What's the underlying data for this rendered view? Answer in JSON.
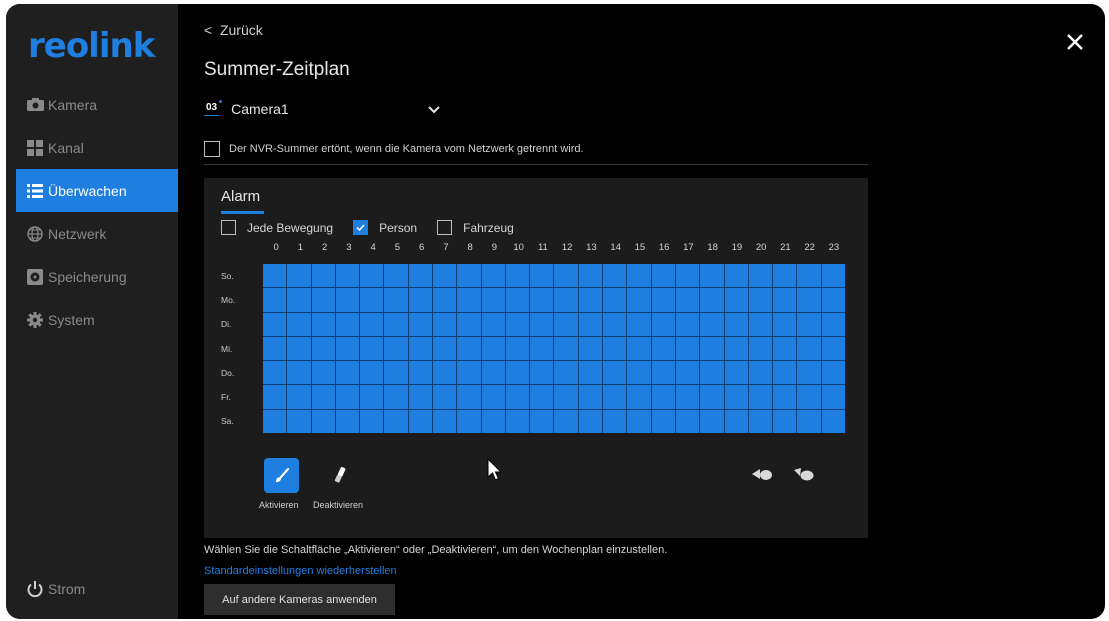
{
  "brand": {
    "logo_text": "reolink",
    "accent_color": "#1f7fe0"
  },
  "sidebar": {
    "items": [
      {
        "label": "Kamera",
        "icon": "camera-icon"
      },
      {
        "label": "Kanal",
        "icon": "grid-icon"
      },
      {
        "label": "Überwachen",
        "icon": "list-icon",
        "active": true
      },
      {
        "label": "Netzwerk",
        "icon": "globe-icon"
      },
      {
        "label": "Speicherung",
        "icon": "storage-icon"
      },
      {
        "label": "System",
        "icon": "gear-icon"
      }
    ],
    "power_label": "Strom"
  },
  "header": {
    "back_label": "Zurück",
    "title": "Summer-Zeitplan",
    "camera_number": "03",
    "camera_name": "Camera1"
  },
  "nvr_option": {
    "label": "Der NVR-Summer ertönt, wenn die Kamera vom Netzwerk getrennt wird.",
    "checked": false
  },
  "schedule": {
    "tab_label": "Alarm",
    "filters": [
      {
        "label": "Jede Bewegung",
        "checked": false
      },
      {
        "label": "Person",
        "checked": true
      },
      {
        "label": "Fahrzeug",
        "checked": false
      }
    ],
    "hours": [
      "0",
      "1",
      "2",
      "3",
      "4",
      "5",
      "6",
      "7",
      "8",
      "9",
      "10",
      "11",
      "12",
      "13",
      "14",
      "15",
      "16",
      "17",
      "18",
      "19",
      "20",
      "21",
      "22",
      "23"
    ],
    "days": [
      "So.",
      "Mo.",
      "Di.",
      "Mi.",
      "Do.",
      "Fr.",
      "Sa."
    ],
    "all_cells_active": true,
    "active_color": "#1f7fe0"
  },
  "tools": {
    "activate_label": "Aktivieren",
    "deactivate_label": "Deaktivieren"
  },
  "footer": {
    "hint": "Wählen Sie die Schaltfläche „Aktivieren“ oder „Deaktivieren“, um den Wochenplan einzustellen.",
    "restore_link": "Standardeinstellungen wiederherstellen",
    "apply_button": "Auf andere Kameras anwenden"
  }
}
